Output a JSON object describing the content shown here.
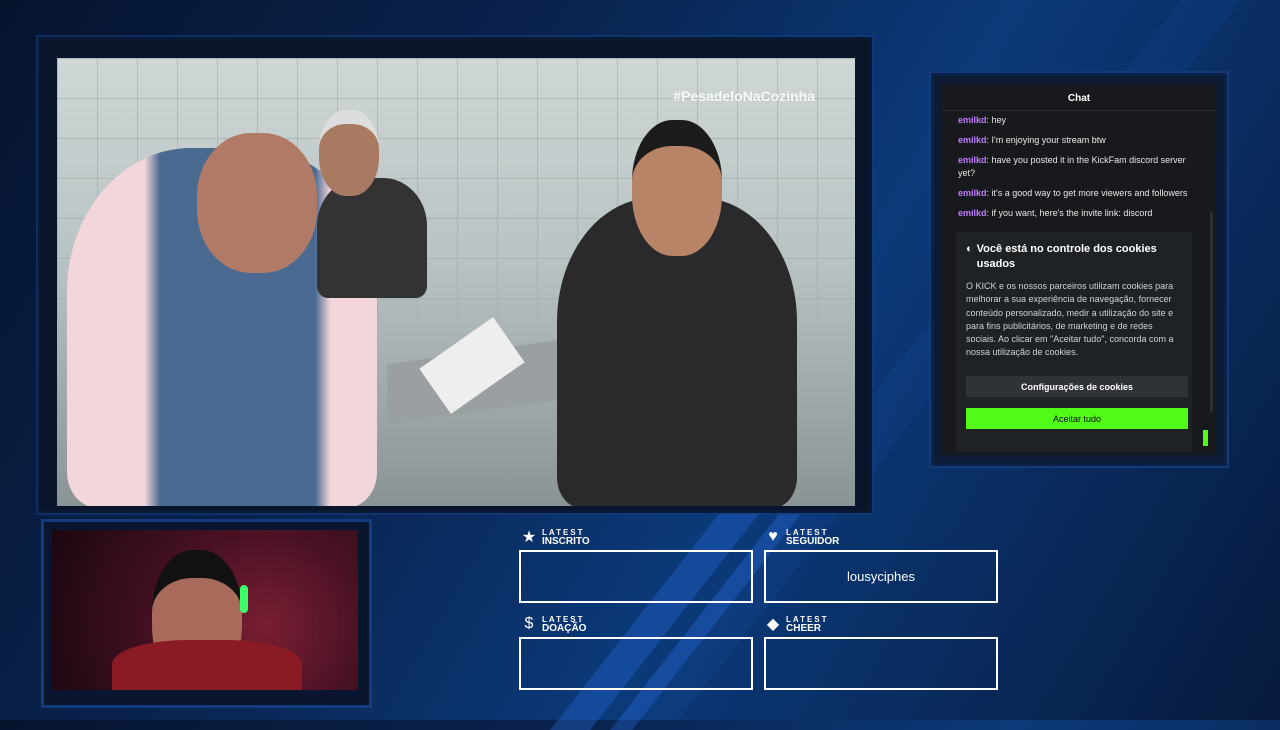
{
  "video": {
    "hashtag": "#PesadeloNaCozinha"
  },
  "chat": {
    "title": "Chat",
    "messages": [
      {
        "user": "emilkd",
        "text": "hey"
      },
      {
        "user": "emilkd",
        "text": "I'm enjoying your stream btw"
      },
      {
        "user": "emilkd",
        "text": "have you posted it in the KickFam discord server yet?"
      },
      {
        "user": "emilkd",
        "text": "it's a good way to get more viewers and followers"
      },
      {
        "user": "emilkd",
        "text": "if you want, here's the invite link: discord"
      }
    ],
    "cookie": {
      "title": "Você está no controle dos cookies usados",
      "body": "O KICK e os nossos parceiros utilizam cookies para melhorar a sua experiência de navegação, fornecer conteúdo personalizado, medir a utilização do site e para fins publicitários, de marketing e de redes sociais. Ao clicar em \"Aceitar tudo\", concorda com a nossa utilização de cookies.",
      "config_label": "Configurações de cookies",
      "accept_label": "Aceitar tudo"
    }
  },
  "widgets": {
    "inscrito": {
      "small": "LATEST",
      "big": "INSCRITO",
      "value": "",
      "icon": "star-icon"
    },
    "seguidor": {
      "small": "LATEST",
      "big": "SEGUIDOR",
      "value": "lousyciphes",
      "icon": "heart-icon"
    },
    "doacao": {
      "small": "LATEST",
      "big": "DOAÇÃO",
      "value": "",
      "icon": "dollar-icon"
    },
    "cheer": {
      "small": "LATEST",
      "big": "CHEER",
      "value": "",
      "icon": "diamond-icon"
    }
  },
  "colors": {
    "kick_green": "#53fc18",
    "username": "#c27bff"
  }
}
